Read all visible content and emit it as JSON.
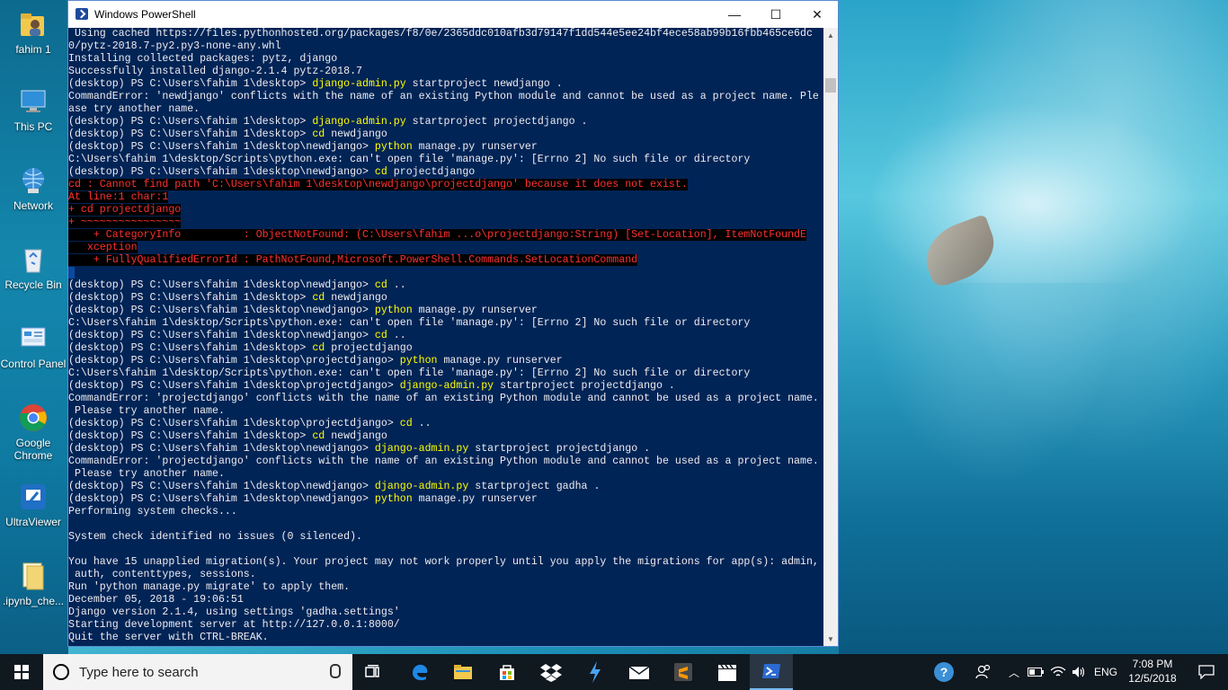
{
  "desktop": {
    "icons": [
      {
        "label": "fahim 1"
      },
      {
        "label": "This PC"
      },
      {
        "label": "Network"
      },
      {
        "label": "Recycle Bin"
      },
      {
        "label": "Control Panel"
      },
      {
        "label": "Google Chrome"
      },
      {
        "label": "UltraViewer"
      },
      {
        "label": ".ipynb_che..."
      }
    ]
  },
  "window": {
    "title": "Windows PowerShell",
    "minimize": "—",
    "maximize": "☐",
    "close": "✕"
  },
  "console": {
    "lines": [
      [
        {
          "t": " Using cached https://files.pythonhosted.org/packages/f8/0e/2365ddc010afb3d79147f1dd544e5ee24bf4ece58ab99b16fbb465ce6dc"
        }
      ],
      [
        {
          "t": "0/pytz-2018.7-py2.py3-none-any.whl"
        }
      ],
      [
        {
          "t": "Installing collected packages: pytz, django"
        }
      ],
      [
        {
          "t": "Successfully installed django-2.1.4 pytz-2018.7"
        }
      ],
      [
        {
          "t": "(desktop) PS C:\\Users\\fahim 1\\desktop> "
        },
        {
          "t": "django-admin.py",
          "c": "cmd"
        },
        {
          "t": " startproject newdjango ."
        }
      ],
      [
        {
          "t": "CommandError: 'newdjango' conflicts with the name of an existing Python module and cannot be used as a project name. Ple"
        }
      ],
      [
        {
          "t": "ase try another name."
        }
      ],
      [
        {
          "t": "(desktop) PS C:\\Users\\fahim 1\\desktop> "
        },
        {
          "t": "django-admin.py",
          "c": "cmd"
        },
        {
          "t": " startproject projectdjango ."
        }
      ],
      [
        {
          "t": "(desktop) PS C:\\Users\\fahim 1\\desktop> "
        },
        {
          "t": "cd",
          "c": "cmd"
        },
        {
          "t": " newdjango"
        }
      ],
      [
        {
          "t": "(desktop) PS C:\\Users\\fahim 1\\desktop\\newdjango> "
        },
        {
          "t": "python",
          "c": "cmd"
        },
        {
          "t": " manage.py runserver"
        }
      ],
      [
        {
          "t": "C:\\Users\\fahim 1\\desktop/Scripts\\python.exe: can't open file 'manage.py': [Errno 2] No such file or directory"
        }
      ],
      [
        {
          "t": "(desktop) PS C:\\Users\\fahim 1\\desktop\\newdjango> "
        },
        {
          "t": "cd",
          "c": "cmd"
        },
        {
          "t": " projectdjango"
        }
      ],
      [
        {
          "t": "cd : Cannot find path 'C:\\Users\\fahim 1\\desktop\\newdjango\\projectdjango' because it does not exist.",
          "c": "err"
        }
      ],
      [
        {
          "t": "At line:1 char:1",
          "c": "err"
        }
      ],
      [
        {
          "t": "+ cd projectdjango",
          "c": "err"
        }
      ],
      [
        {
          "t": "+ ~~~~~~~~~~~~~~~~",
          "c": "err"
        }
      ],
      [
        {
          "t": "    + CategoryInfo          : ObjectNotFound: (C:\\Users\\fahim ...o\\projectdjango:String) [Set-Location], ItemNotFoundE",
          "c": "err"
        }
      ],
      [
        {
          "t": "   xception",
          "c": "err"
        }
      ],
      [
        {
          "t": "    + FullyQualifiedErrorId : PathNotFound,Microsoft.PowerShell.Commands.SetLocationCommand",
          "c": "err"
        }
      ],
      [
        {
          "t": " ",
          "c": "sel"
        }
      ],
      [
        {
          "t": "(desktop) PS C:\\Users\\fahim 1\\desktop\\newdjango> "
        },
        {
          "t": "cd",
          "c": "cmd"
        },
        {
          "t": " .."
        }
      ],
      [
        {
          "t": "(desktop) PS C:\\Users\\fahim 1\\desktop> "
        },
        {
          "t": "cd",
          "c": "cmd"
        },
        {
          "t": " newdjango"
        }
      ],
      [
        {
          "t": "(desktop) PS C:\\Users\\fahim 1\\desktop\\newdjango> "
        },
        {
          "t": "python",
          "c": "cmd"
        },
        {
          "t": " manage.py runserver"
        }
      ],
      [
        {
          "t": "C:\\Users\\fahim 1\\desktop/Scripts\\python.exe: can't open file 'manage.py': [Errno 2] No such file or directory"
        }
      ],
      [
        {
          "t": "(desktop) PS C:\\Users\\fahim 1\\desktop\\newdjango> "
        },
        {
          "t": "cd",
          "c": "cmd"
        },
        {
          "t": " .."
        }
      ],
      [
        {
          "t": "(desktop) PS C:\\Users\\fahim 1\\desktop> "
        },
        {
          "t": "cd",
          "c": "cmd"
        },
        {
          "t": " projectdjango"
        }
      ],
      [
        {
          "t": "(desktop) PS C:\\Users\\fahim 1\\desktop\\projectdjango> "
        },
        {
          "t": "python",
          "c": "cmd"
        },
        {
          "t": " manage.py runserver"
        }
      ],
      [
        {
          "t": "C:\\Users\\fahim 1\\desktop/Scripts\\python.exe: can't open file 'manage.py': [Errno 2] No such file or directory"
        }
      ],
      [
        {
          "t": "(desktop) PS C:\\Users\\fahim 1\\desktop\\projectdjango> "
        },
        {
          "t": "django-admin.py",
          "c": "cmd"
        },
        {
          "t": " startproject projectdjango ."
        }
      ],
      [
        {
          "t": "CommandError: 'projectdjango' conflicts with the name of an existing Python module and cannot be used as a project name."
        }
      ],
      [
        {
          "t": " Please try another name."
        }
      ],
      [
        {
          "t": "(desktop) PS C:\\Users\\fahim 1\\desktop\\projectdjango> "
        },
        {
          "t": "cd",
          "c": "cmd"
        },
        {
          "t": " .."
        }
      ],
      [
        {
          "t": "(desktop) PS C:\\Users\\fahim 1\\desktop> "
        },
        {
          "t": "cd",
          "c": "cmd"
        },
        {
          "t": " newdjango"
        }
      ],
      [
        {
          "t": "(desktop) PS C:\\Users\\fahim 1\\desktop\\newdjango> "
        },
        {
          "t": "django-admin.py",
          "c": "cmd"
        },
        {
          "t": " startproject projectdjango ."
        }
      ],
      [
        {
          "t": "CommandError: 'projectdjango' conflicts with the name of an existing Python module and cannot be used as a project name."
        }
      ],
      [
        {
          "t": " Please try another name."
        }
      ],
      [
        {
          "t": "(desktop) PS C:\\Users\\fahim 1\\desktop\\newdjango> "
        },
        {
          "t": "django-admin.py",
          "c": "cmd"
        },
        {
          "t": " startproject gadha ."
        }
      ],
      [
        {
          "t": "(desktop) PS C:\\Users\\fahim 1\\desktop\\newdjango> "
        },
        {
          "t": "python",
          "c": "cmd"
        },
        {
          "t": " manage.py runserver"
        }
      ],
      [
        {
          "t": "Performing system checks..."
        }
      ],
      [
        {
          "t": ""
        }
      ],
      [
        {
          "t": "System check identified no issues (0 silenced)."
        }
      ],
      [
        {
          "t": ""
        }
      ],
      [
        {
          "t": "You have 15 unapplied migration(s). Your project may not work properly until you apply the migrations for app(s): admin,"
        }
      ],
      [
        {
          "t": " auth, contenttypes, sessions."
        }
      ],
      [
        {
          "t": "Run 'python manage.py migrate' to apply them."
        }
      ],
      [
        {
          "t": "December 05, 2018 - 19:06:51"
        }
      ],
      [
        {
          "t": "Django version 2.1.4, using settings 'gadha.settings'"
        }
      ],
      [
        {
          "t": "Starting development server at http://127.0.0.1:8000/"
        }
      ],
      [
        {
          "t": "Quit the server with CTRL-BREAK."
        }
      ]
    ]
  },
  "taskbar": {
    "search_placeholder": "Type here to search",
    "apps": [
      "task-view",
      "edge",
      "file-explorer",
      "store",
      "dropbox",
      "visual-studio-code",
      "mail",
      "sublime-text",
      "movies-tv",
      "powershell"
    ],
    "language": "ENG",
    "time": "7:08 PM",
    "date": "12/5/2018"
  },
  "colors": {
    "console_bg": "#012456",
    "console_text": "#eeedf0",
    "command": "#ffff00",
    "error": "#ff3030"
  }
}
